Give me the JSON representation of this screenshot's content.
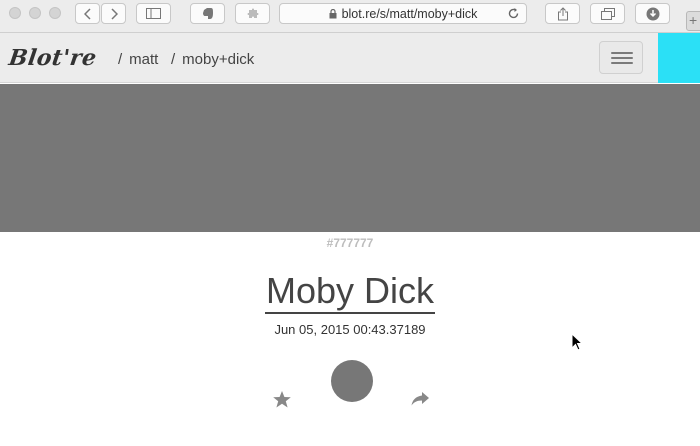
{
  "browser": {
    "url": "blot.re/s/matt/moby+dick",
    "new_tab": "+"
  },
  "navbar": {
    "logo": "Blot're",
    "breadcrumbs": [
      {
        "sep": "/",
        "label": "matt"
      },
      {
        "sep": "/",
        "label": "moby+dick"
      }
    ],
    "accent_color": "#2be0f6"
  },
  "stream": {
    "color": "#777777",
    "color_label": "#777777",
    "title": "Moby Dick",
    "updated": "Jun 05, 2015 00:43.37189"
  },
  "icons": {
    "favorite": "star-icon",
    "share": "share-arrow-icon",
    "status": "color-dot-icon"
  }
}
